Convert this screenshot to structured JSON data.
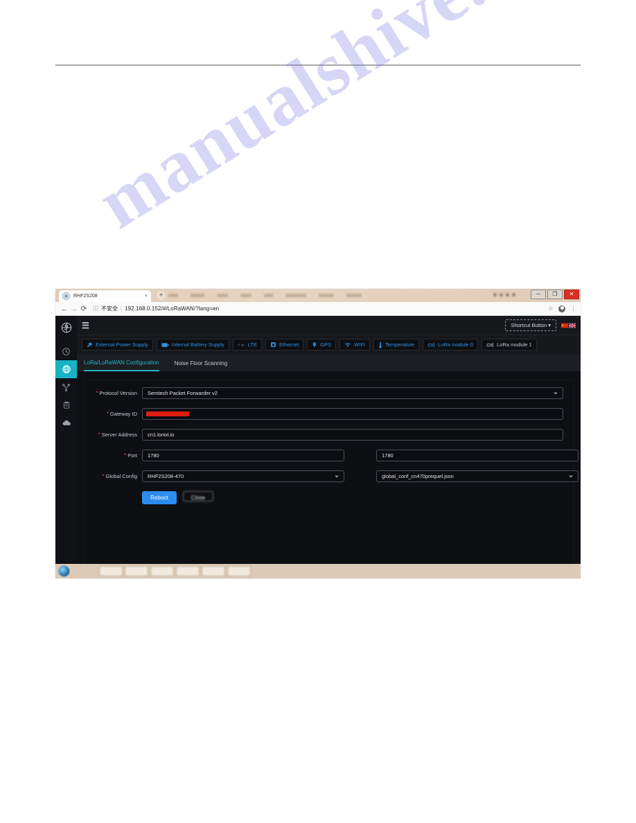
{
  "document": {
    "watermark": "manualshive.com"
  },
  "browser": {
    "tab": {
      "title": "RHF2S208",
      "favicon_icon": "globe-favicon",
      "close_icon": "×"
    },
    "new_tab_icon": "+",
    "window_controls": {
      "minimize": "─",
      "restore": "❐",
      "close": "✕"
    },
    "nav": {
      "back_icon": "←",
      "forward_icon": "→",
      "reload_icon": "⟳"
    },
    "omnibox": {
      "security_icon": "ⓘ",
      "security_label": "不安全",
      "separator": "|",
      "url": "192.168.0.152/#/LoRaWAN/?lang=en"
    },
    "toolbar_right": {
      "bookmark_icon": "☆",
      "profile_icon": "profile-avatar",
      "menu_icon": "⋮"
    }
  },
  "app": {
    "sidebar": {
      "logo_name": "rak-logo",
      "items": [
        {
          "name": "dashboard",
          "icon": "clock-pie-icon",
          "active": false
        },
        {
          "name": "network",
          "icon": "globe-icon",
          "active": true
        },
        {
          "name": "topology",
          "icon": "fork-node-icon",
          "active": false
        },
        {
          "name": "logs",
          "icon": "clipboard-icon",
          "active": false
        },
        {
          "name": "cloud",
          "icon": "cloud-icon",
          "active": false
        }
      ]
    },
    "topbar": {
      "menu_toggle_icon": "☰",
      "shortcut_button": "Shortcut Button",
      "shortcut_caret": "▾",
      "flags": [
        "cn-flag",
        "uk-flag"
      ]
    },
    "status_chips": [
      {
        "label": "External Power Supply",
        "icon": "power-plug-icon",
        "tone": "accent"
      },
      {
        "label": "Internal Battery Supply",
        "icon": "battery-icon",
        "tone": "accent"
      },
      {
        "label": "LTE",
        "icon": "4g-signal-icon",
        "tone": "accent"
      },
      {
        "label": "Ethernet",
        "icon": "ethernet-icon",
        "tone": "accent"
      },
      {
        "label": "GPS",
        "icon": "location-pin-icon",
        "tone": "accent"
      },
      {
        "label": "WIFI",
        "icon": "wifi-icon",
        "tone": "accent"
      },
      {
        "label": "Temperature",
        "icon": "thermometer-icon",
        "tone": "accent"
      },
      {
        "label": "LoRa module 0",
        "icon": "antenna-icon",
        "tone": "accent"
      },
      {
        "label": "LoRa module 1",
        "icon": "antenna-icon",
        "tone": "muted"
      }
    ],
    "tabs": [
      {
        "label": "LoRa/LoRaWAN Configuration",
        "active": true
      },
      {
        "label": "Noise Floor Scanning",
        "active": false
      }
    ],
    "form": {
      "protocol_version": {
        "label": "Protocol Version",
        "value": "Semtech Packet Forwarder v2",
        "required": true,
        "type": "select"
      },
      "gateway_id": {
        "label": "Gateway ID",
        "value": "",
        "required": true,
        "type": "text",
        "redacted": true
      },
      "server_address": {
        "label": "Server Address",
        "value": "cn1.loriot.io",
        "required": true,
        "type": "text"
      },
      "port": {
        "label": "Port",
        "value": "1780",
        "required": true,
        "type": "text"
      },
      "port_secondary": {
        "value": "1780",
        "type": "text"
      },
      "global_config": {
        "label": "Global Config",
        "value": "RHF2S208-470",
        "required": true,
        "type": "select"
      },
      "global_config_file": {
        "value": "global_conf_cn470prequel.json",
        "type": "select"
      },
      "buttons": {
        "reboot": "Reboot",
        "close": "Close"
      }
    },
    "colors": {
      "accent_blue": "#2f8fe0",
      "active_teal": "#25b8c6",
      "primary_button": "#2d8cf0",
      "required_red": "#e0483a",
      "panel_bg": "#0d0f12"
    }
  }
}
